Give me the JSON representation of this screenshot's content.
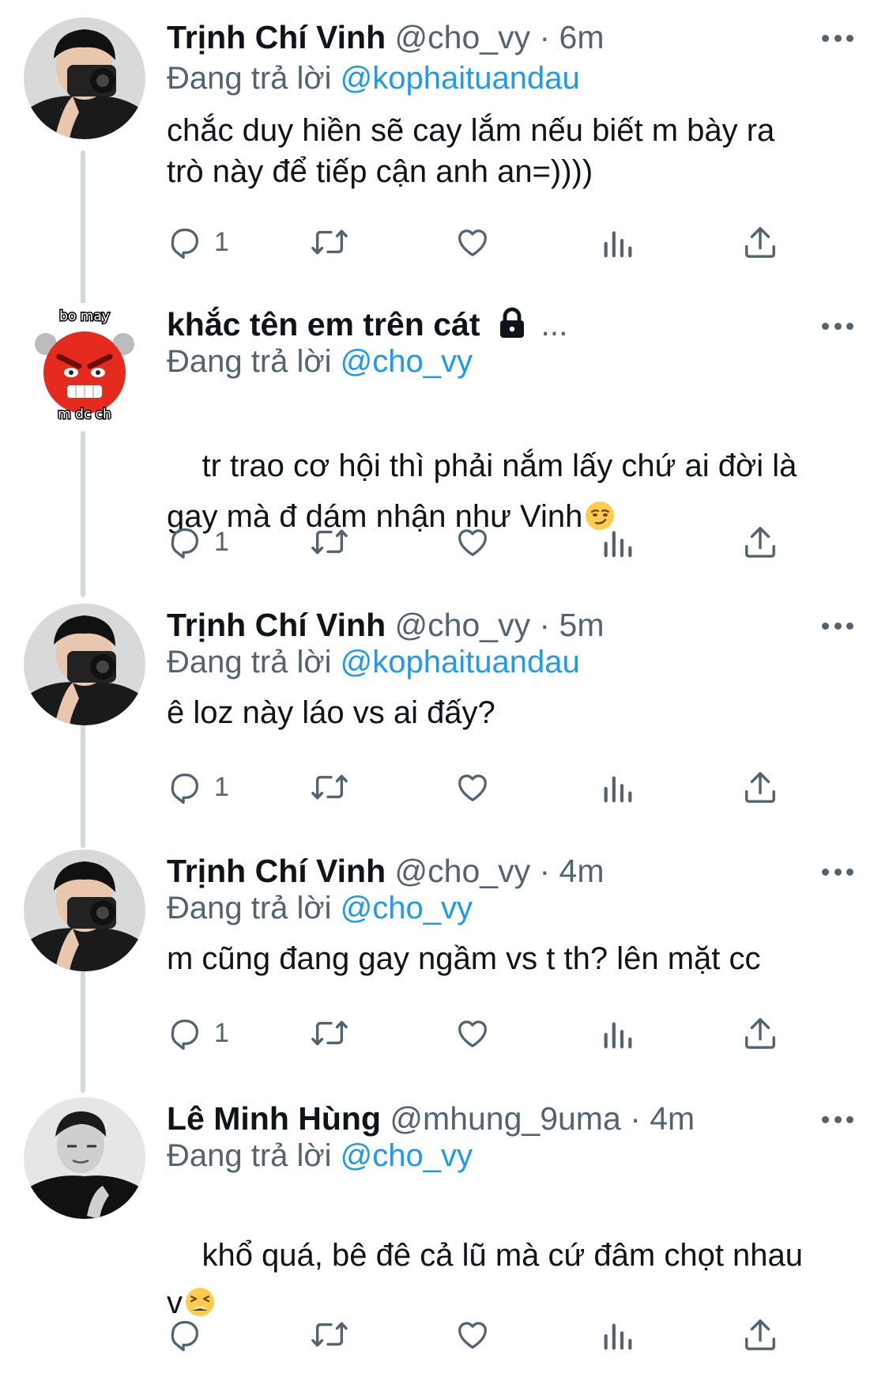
{
  "tweets": [
    {
      "name": "Trịnh Chí Vinh",
      "handle": "@cho_vy",
      "dot": "·",
      "time": "6m",
      "reply_prefix": "Đang trả lời",
      "reply_to": "@kophaituandau",
      "text": "chắc duy hiền sẽ cay lắm nếu biết m bày ra\ntrò này để tiếp cận anh an=))))",
      "reply_count": "1"
    },
    {
      "name": "khắc tên em trên cát",
      "ellipsis": "...",
      "reply_prefix": "Đang trả lời",
      "reply_to": "@cho_vy",
      "text": "tr trao cơ hội thì phải nắm lấy chứ ai đời là\ngay mà đ dám nhận như Vinh",
      "emoji": "smirk-emoji",
      "reply_count": "1",
      "avatar_text_top": "bo may",
      "avatar_text_bottom": "m dc ch"
    },
    {
      "name": "Trịnh Chí Vinh",
      "handle": "@cho_vy",
      "dot": "·",
      "time": "5m",
      "reply_prefix": "Đang trả lời",
      "reply_to": "@kophaituandau",
      "text": "ê loz này láo vs ai đấy?",
      "reply_count": "1"
    },
    {
      "name": "Trịnh Chí Vinh",
      "handle": "@cho_vy",
      "dot": "·",
      "time": "4m",
      "reply_prefix": "Đang trả lời",
      "reply_to": "@cho_vy",
      "text": "m cũng đang gay ngầm vs t th? lên mặt cc",
      "reply_count": "1"
    },
    {
      "name": "Lê Minh Hùng",
      "handle": "@mhung_9uma",
      "dot": "·",
      "time": "4m",
      "reply_prefix": "Đang trả lời",
      "reply_to": "@cho_vy",
      "text": "khổ quá, bê đê cả lũ mà cứ đâm chọt nhau\nv",
      "emoji": "tired-face-emoji",
      "reply_count": ""
    }
  ],
  "icons": {
    "reply": "reply-icon",
    "retweet": "retweet-icon",
    "like": "like-icon",
    "views": "views-icon",
    "share": "share-icon",
    "more": "more-icon",
    "lock": "lock-icon"
  },
  "colors": {
    "text": "#0f1419",
    "secondary": "#536471",
    "mention": "#1d9bf0",
    "thread_line": "#cfd9de"
  }
}
